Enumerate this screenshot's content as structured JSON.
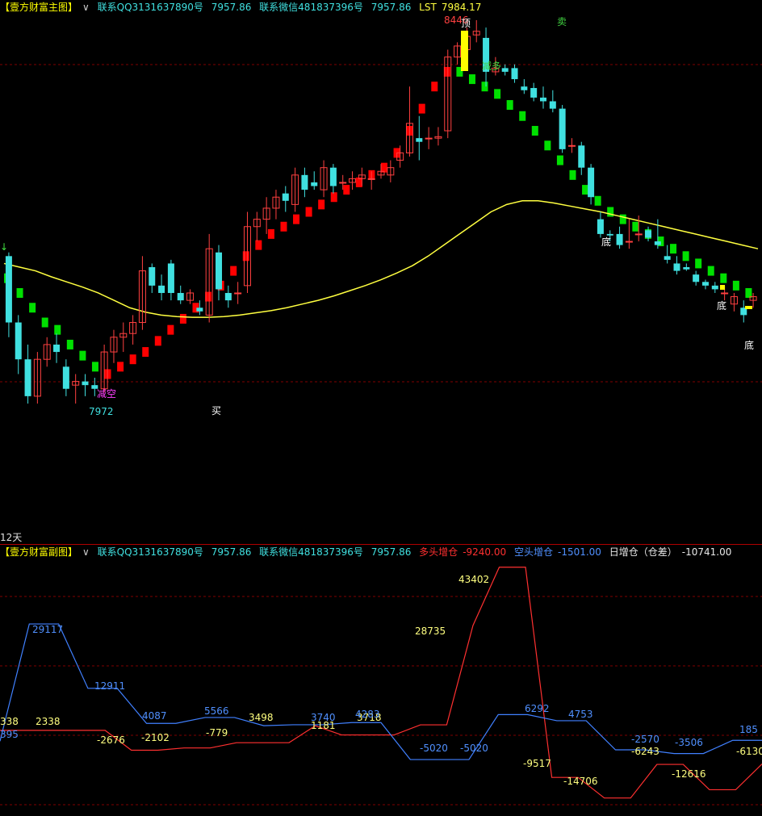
{
  "main_header": {
    "title": "【壹方财富主图】",
    "contact_qq": "联系QQ3131637890号",
    "qq_value": "7957.86",
    "contact_wx": "联系微信481837396号",
    "wx_value": "7957.86",
    "lst_label": "LST",
    "lst_value": "7984.17"
  },
  "sub_header": {
    "title": "【壹方财富副图】",
    "contact_qq": "联系QQ3131637890号",
    "qq_value": "7957.86",
    "contact_wx": "联系微信481837396号",
    "wx_value": "7957.86",
    "long_label": "多头增仓",
    "long_value": "-9240.00",
    "short_label": "空头增仓",
    "short_value": "-1501.00",
    "diff_label": "日增仓（仓差）",
    "diff_value": "-10741.00"
  },
  "period_label": "12天",
  "colors": {
    "bull_candle": "#ff4040",
    "bear_candle": "#40e0e0",
    "ma_line": "#ffff40",
    "trend_up": "#ff0000",
    "trend_down": "#00e000",
    "long_line": "#ff3030",
    "short_line": "#4080ff",
    "grid": "#800000"
  },
  "chart_data": [
    {
      "type": "candlestick",
      "price_labels": [
        "8446",
        "7972"
      ],
      "annotations": [
        {
          "text": "顶",
          "color": "#ffffff"
        },
        {
          "text": "卖",
          "color": "#40d040"
        },
        {
          "text": "减多",
          "color": "#40d040"
        },
        {
          "text": "减空",
          "color": "#ff40ff"
        },
        {
          "text": "买",
          "color": "#ffffff"
        },
        {
          "text": "底",
          "color": "#ffffff"
        },
        {
          "text": "底",
          "color": "#ffffff"
        },
        {
          "text": "底",
          "color": "#ffffff"
        }
      ],
      "ohlc": [
        [
          8150,
          8155,
          8040,
          8060
        ],
        [
          8060,
          8070,
          7990,
          8010
        ],
        [
          8010,
          8030,
          7950,
          7960
        ],
        [
          7960,
          8020,
          7950,
          8010
        ],
        [
          8010,
          8040,
          8000,
          8030
        ],
        [
          8030,
          8045,
          8005,
          8020
        ],
        [
          8000,
          8010,
          7960,
          7970
        ],
        [
          7975,
          7990,
          7950,
          7980
        ],
        [
          7980,
          7990,
          7960,
          7975
        ],
        [
          7975,
          7985,
          7960,
          7970
        ],
        [
          7970,
          8030,
          7965,
          8020
        ],
        [
          8020,
          8050,
          8005,
          8040
        ],
        [
          8040,
          8060,
          8020,
          8045
        ],
        [
          8045,
          8070,
          8030,
          8060
        ],
        [
          8060,
          8150,
          8050,
          8130
        ],
        [
          8135,
          8140,
          8100,
          8110
        ],
        [
          8110,
          8125,
          8090,
          8100
        ],
        [
          8140,
          8145,
          8090,
          8100
        ],
        [
          8100,
          8110,
          8085,
          8090
        ],
        [
          8090,
          8105,
          8085,
          8100
        ],
        [
          8080,
          8090,
          8070,
          8075
        ],
        [
          8070,
          8180,
          8060,
          8160
        ],
        [
          8155,
          8165,
          8090,
          8105
        ],
        [
          8100,
          8110,
          8080,
          8090
        ],
        [
          8100,
          8115,
          8085,
          8100
        ],
        [
          8110,
          8210,
          8100,
          8190
        ],
        [
          8190,
          8210,
          8170,
          8200
        ],
        [
          8200,
          8230,
          8180,
          8215
        ],
        [
          8215,
          8240,
          8200,
          8230
        ],
        [
          8235,
          8245,
          8210,
          8225
        ],
        [
          8220,
          8270,
          8210,
          8260
        ],
        [
          8260,
          8270,
          8230,
          8240
        ],
        [
          8250,
          8265,
          8240,
          8245
        ],
        [
          8240,
          8280,
          8230,
          8270
        ],
        [
          8270,
          8275,
          8235,
          8245
        ],
        [
          8250,
          8260,
          8240,
          8250
        ],
        [
          8250,
          8265,
          8240,
          8255
        ],
        [
          8255,
          8270,
          8245,
          8260
        ],
        [
          8255,
          8265,
          8240,
          8255
        ],
        [
          8260,
          8275,
          8255,
          8265
        ],
        [
          8260,
          8280,
          8250,
          8270
        ],
        [
          8280,
          8300,
          8270,
          8290
        ],
        [
          8290,
          8380,
          8285,
          8330
        ],
        [
          8310,
          8340,
          8280,
          8305
        ],
        [
          8310,
          8325,
          8295,
          8310
        ],
        [
          8310,
          8325,
          8300,
          8312
        ],
        [
          8320,
          8430,
          8310,
          8420
        ],
        [
          8420,
          8440,
          8410,
          8435
        ],
        [
          8430,
          8460,
          8420,
          8448
        ],
        [
          8450,
          8470,
          8440,
          8455
        ],
        [
          8446,
          8460,
          8380,
          8400
        ],
        [
          8400,
          8420,
          8395,
          8405
        ],
        [
          8405,
          8410,
          8395,
          8400
        ],
        [
          8405,
          8410,
          8385,
          8390
        ],
        [
          8380,
          8390,
          8370,
          8375
        ],
        [
          8378,
          8385,
          8360,
          8365
        ],
        [
          8365,
          8380,
          8350,
          8360
        ],
        [
          8360,
          8375,
          8345,
          8350
        ],
        [
          8350,
          8355,
          8290,
          8295
        ],
        [
          8300,
          8310,
          8290,
          8300
        ],
        [
          8300,
          8305,
          8260,
          8270
        ],
        [
          8270,
          8275,
          8220,
          8230
        ],
        [
          8200,
          8210,
          8175,
          8180
        ],
        [
          8180,
          8185,
          8170,
          8178
        ],
        [
          8180,
          8190,
          8160,
          8165
        ],
        [
          8170,
          8200,
          8160,
          8170
        ],
        [
          8180,
          8205,
          8170,
          8180
        ],
        [
          8185,
          8190,
          8170,
          8175
        ],
        [
          8170,
          8200,
          8160,
          8165
        ],
        [
          8150,
          8165,
          8140,
          8145
        ],
        [
          8140,
          8150,
          8125,
          8130
        ],
        [
          8135,
          8140,
          8130,
          8132
        ],
        [
          8125,
          8130,
          8110,
          8115
        ],
        [
          8115,
          8118,
          8105,
          8110
        ],
        [
          8110,
          8115,
          8100,
          8105
        ],
        [
          8100,
          8110,
          8090,
          8100
        ],
        [
          8085,
          8100,
          8075,
          8095
        ],
        [
          8080,
          8090,
          8060,
          8070
        ],
        [
          8090,
          8100,
          8080,
          8095
        ]
      ],
      "ma": [
        8140,
        8135,
        8130,
        8122,
        8115,
        8108,
        8100,
        8090,
        8080,
        8074,
        8070,
        8068,
        8067,
        8067,
        8068,
        8070,
        8073,
        8076,
        8080,
        8085,
        8090,
        8096,
        8103,
        8110,
        8118,
        8127,
        8137,
        8150,
        8165,
        8180,
        8195,
        8210,
        8220,
        8225,
        8225,
        8222,
        8218,
        8214,
        8210,
        8205,
        8200,
        8195,
        8190,
        8185,
        8180,
        8175,
        8170,
        8165,
        8160
      ],
      "trend": [
        8120,
        8100,
        8080,
        8060,
        8050,
        8030,
        8015,
        8000,
        7990,
        8000,
        8010,
        8020,
        8035,
        8050,
        8065,
        8080,
        8095,
        8110,
        8130,
        8150,
        8165,
        8180,
        8190,
        8200,
        8210,
        8220,
        8230,
        8240,
        8250,
        8260,
        8270,
        8290,
        8320,
        8350,
        8380,
        8400,
        8400,
        8390,
        8380,
        8370,
        8355,
        8340,
        8320,
        8300,
        8280,
        8260,
        8240,
        8225,
        8210,
        8200,
        8190,
        8180,
        8170,
        8160,
        8150,
        8140,
        8130,
        8120,
        8110,
        8100
      ]
    },
    {
      "type": "line",
      "series": [
        {
          "name": "多头增仓",
          "values": [
            2338,
            2338,
            2338,
            2338,
            2338,
            -2676,
            -2676,
            -2102,
            -2102,
            -779,
            -779,
            -779,
            3498,
            1181,
            1181,
            1181,
            3718,
            3718,
            28735,
            43402,
            43402,
            -9517,
            -9517,
            -14706,
            -14706,
            -6243,
            -6243,
            -12616,
            -12616,
            -6130
          ]
        },
        {
          "name": "空头增仓",
          "values": [
            -395,
            29117,
            29117,
            12911,
            12911,
            4087,
            4087,
            5566,
            5566,
            3498,
            3740,
            3740,
            4283,
            4283,
            -5020,
            -5020,
            -5020,
            6292,
            6292,
            4753,
            4753,
            -2570,
            -2570,
            -3506,
            -3506,
            -185,
            -185
          ]
        }
      ],
      "value_labels": [
        "338",
        "2338",
        "-2676",
        "-2102",
        "-779",
        "3498",
        "1181",
        "3718",
        "28735",
        "43402",
        "-9517",
        "-14706",
        "-6243",
        "-12616",
        "-6130",
        "395",
        "29117",
        "12911",
        "4087",
        "5566",
        "3740",
        "4283",
        "-5020",
        "-5020",
        "6292",
        "4753",
        "-2570",
        "-3506",
        "185"
      ]
    }
  ]
}
